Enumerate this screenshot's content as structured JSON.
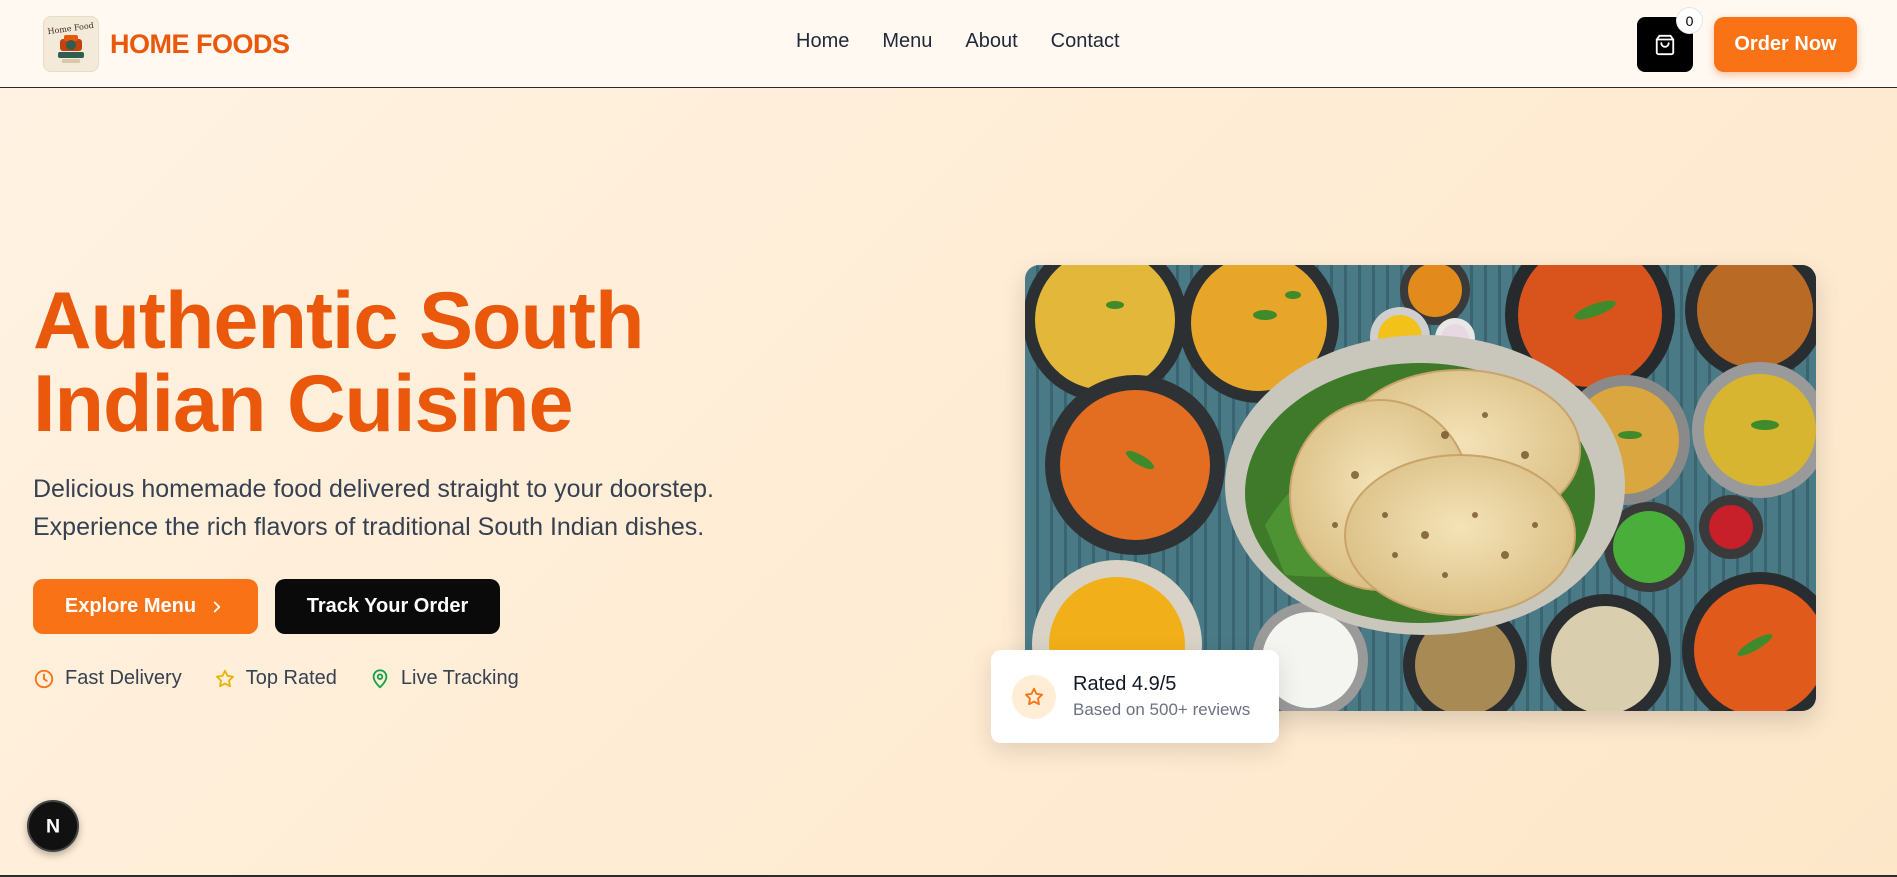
{
  "header": {
    "logo_text": "Home Food",
    "brand": "HOME FOODS",
    "nav": [
      "Home",
      "Menu",
      "About",
      "Contact"
    ],
    "cart_count": "0",
    "order_label": "Order Now"
  },
  "hero": {
    "title_line1": "Authentic South",
    "title_line2": "Indian Cuisine",
    "subtitle_line1": "Delicious homemade food delivered straight to your doorstep.",
    "subtitle_line2": "Experience the rich flavors of traditional South Indian dishes.",
    "explore_label": "Explore Menu",
    "track_label": "Track Your Order",
    "features": [
      {
        "icon": "clock-icon",
        "label": "Fast Delivery"
      },
      {
        "icon": "star-icon",
        "label": "Top Rated"
      },
      {
        "icon": "map-pin-icon",
        "label": "Live Tracking"
      }
    ]
  },
  "rating": {
    "title": "Rated 4.9/5",
    "subtitle": "Based on 500+ reviews"
  },
  "dev_badge": {
    "letter": "N"
  },
  "colors": {
    "accent": "#f97316",
    "accent_dark": "#ea580c",
    "clock": "#f97316",
    "star": "#eab308",
    "pin": "#16a34a"
  }
}
